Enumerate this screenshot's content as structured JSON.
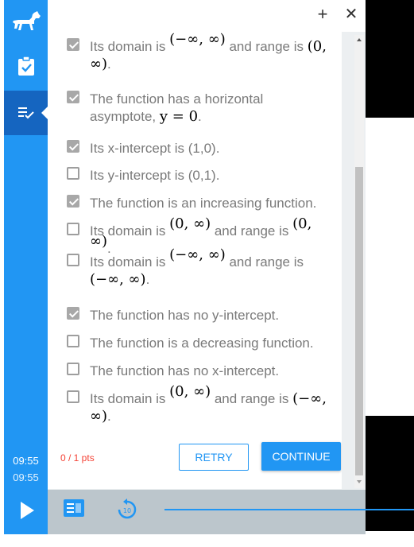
{
  "topbar": {
    "plus_icon": "plus-icon",
    "close_icon": "close-icon"
  },
  "rail": {
    "time_elapsed": "09:55",
    "time_total": "09:55",
    "icons": [
      "dog-logo-icon",
      "clipboard-check-icon",
      "list-check-icon"
    ]
  },
  "options": [
    {
      "checked": true,
      "pre": "Its domain is ",
      "m1": "(−∞, ∞)",
      "mid": " and range is ",
      "m2": "(0, ∞)",
      "end": "."
    },
    {
      "checked": true,
      "pre": "The function has a horizontal asymptote, ",
      "m1": "y = 0",
      "end": "."
    },
    {
      "checked": true,
      "text": "Its x-intercept is (1,0)."
    },
    {
      "checked": false,
      "text": "Its y-intercept is (0,1)."
    },
    {
      "checked": true,
      "text": "The function is an increasing function."
    },
    {
      "checked": false,
      "pre": "Its domain is ",
      "m1": "(0, ∞)",
      "mid": " and range is ",
      "m2": "(0, ∞)",
      "end": "."
    },
    {
      "checked": false,
      "pre": "Its domain is ",
      "m1": "(−∞, ∞)",
      "mid": " and range is ",
      "m2": "(−∞, ∞)",
      "end": "."
    },
    {
      "checked": true,
      "text": "The function has no y-intercept."
    },
    {
      "checked": false,
      "text": "The function is a decreasing function."
    },
    {
      "checked": false,
      "text": "The function has no x-intercept."
    },
    {
      "checked": false,
      "pre": "Its domain is ",
      "m1": "(0, ∞)",
      "mid": " and range is ",
      "m2": "(−∞, ∞)",
      "end": "."
    }
  ],
  "footer": {
    "score": "0 / 1 pts",
    "retry": "RETRY",
    "continue": "CONTINUE"
  },
  "player": {
    "progress": 1.0
  },
  "colors": {
    "accent": "#2196f3",
    "accent_dark": "#1565c0",
    "score": "#f44336"
  }
}
